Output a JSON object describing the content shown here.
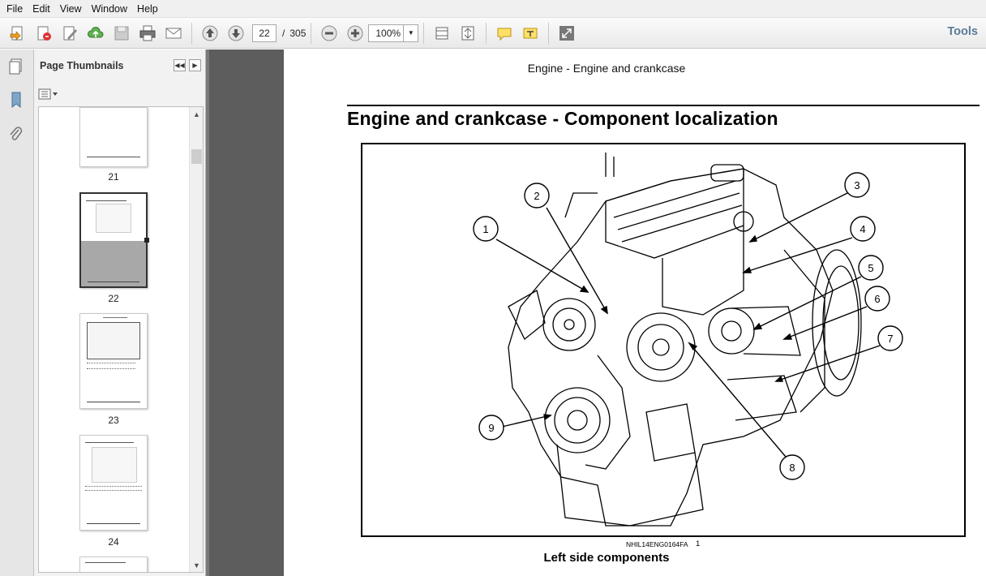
{
  "menu": [
    "File",
    "Edit",
    "View",
    "Window",
    "Help"
  ],
  "toolbar": {
    "page_current": "22",
    "page_total": "305",
    "zoom": "100%",
    "tools_label": "Tools"
  },
  "panel": {
    "title": "Page Thumbnails",
    "thumbnails": [
      {
        "label": "21"
      },
      {
        "label": "22",
        "selected": true
      },
      {
        "label": "23"
      },
      {
        "label": "24"
      }
    ]
  },
  "document": {
    "running_header": "Engine - Engine and crankcase",
    "section_title": "Engine and crankcase - Component localization",
    "figure_id": "NHIL14ENG0164FA",
    "figure_number": "1",
    "figure_caption": "Left side components",
    "callouts": [
      "1",
      "2",
      "3",
      "4",
      "5",
      "6",
      "7",
      "8",
      "9"
    ]
  },
  "colors": {
    "toolbar_bg": "#ececec",
    "doc_background": "#5d5d5d",
    "tools_text": "#5a7a9a"
  }
}
